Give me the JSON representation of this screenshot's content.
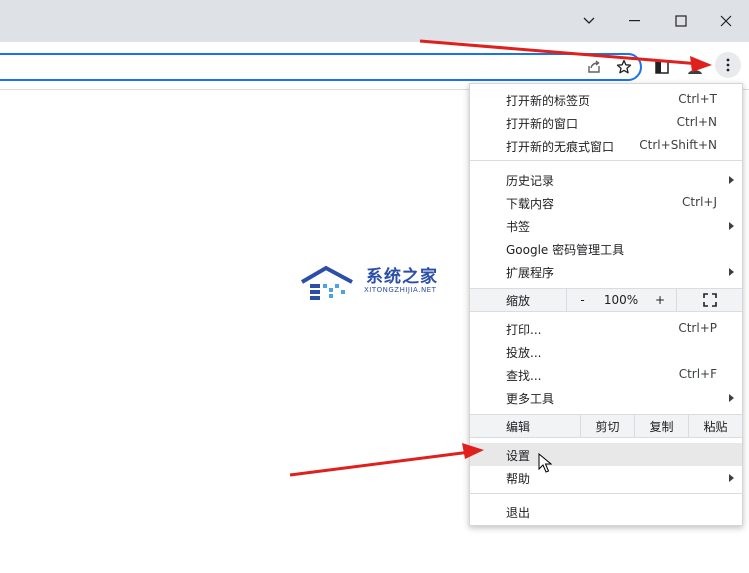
{
  "colors": {
    "titlebar_bg": "#dee1e6",
    "omnibox_border": "#1a73e8",
    "annotation_arrow": "#e0201c",
    "watermark": "#2b4ea8"
  },
  "window_controls": {
    "tab_search_icon": "chevron-down-icon",
    "minimize_icon": "minimize-icon",
    "maximize_icon": "maximize-icon",
    "close_icon": "close-icon"
  },
  "toolbar": {
    "icons": [
      "share-icon",
      "star-icon",
      "side-panel-icon",
      "profile-icon",
      "more-vert-icon"
    ]
  },
  "watermark": {
    "title": "系统之家",
    "subtitle": "XITONGZHIJIA.NET"
  },
  "menu": {
    "group1": [
      {
        "label": "打开新的标签页",
        "shortcut": "Ctrl+T"
      },
      {
        "label": "打开新的窗口",
        "shortcut": "Ctrl+N"
      },
      {
        "label": "打开新的无痕式窗口",
        "shortcut": "Ctrl+Shift+N"
      }
    ],
    "group2": [
      {
        "label": "历史记录",
        "shortcut": ""
      },
      {
        "label": "下载内容",
        "shortcut": "Ctrl+J"
      },
      {
        "label": "书签",
        "shortcut": ""
      },
      {
        "label": "Google 密码管理工具",
        "shortcut": ""
      },
      {
        "label": "扩展程序",
        "shortcut": ""
      }
    ],
    "zoom": {
      "label": "缩放",
      "minus": "-",
      "value": "100%",
      "plus": "+"
    },
    "group3": [
      {
        "label": "打印...",
        "shortcut": "Ctrl+P"
      },
      {
        "label": "投放...",
        "shortcut": ""
      },
      {
        "label": "查找...",
        "shortcut": "Ctrl+F"
      },
      {
        "label": "更多工具",
        "shortcut": ""
      }
    ],
    "edit": {
      "label": "编辑",
      "cut": "剪切",
      "copy": "复制",
      "paste": "粘贴"
    },
    "group4": [
      {
        "label": "设置",
        "shortcut": ""
      },
      {
        "label": "帮助",
        "shortcut": ""
      }
    ],
    "exit": {
      "label": "退出"
    }
  }
}
